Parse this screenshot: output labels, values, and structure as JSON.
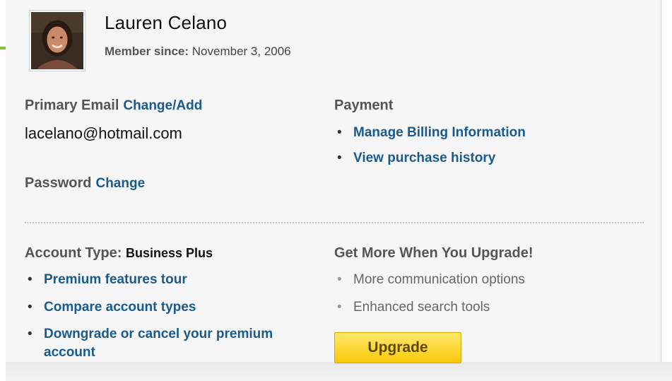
{
  "profile": {
    "name": "Lauren Celano",
    "member_label": "Member since:",
    "member_date": "November 3, 2006",
    "avatar_icon": "profile-photo"
  },
  "email": {
    "label": "Primary Email",
    "change_link": "Change/Add",
    "value": "lacelano@hotmail.com"
  },
  "password": {
    "label": "Password",
    "change_link": "Change"
  },
  "payment": {
    "label": "Payment",
    "links": [
      "Manage Billing Information",
      "View purchase history"
    ]
  },
  "account": {
    "type_label": "Account Type:",
    "type_value": "Business Plus",
    "links": [
      "Premium features tour",
      "Compare account types",
      "Downgrade or cancel your premium account"
    ]
  },
  "upgrade": {
    "heading": "Get More When You Upgrade!",
    "features": [
      "More communication options",
      "Enhanced search tools"
    ],
    "button_label": "Upgrade"
  },
  "colors": {
    "link": "#1a5a8c",
    "button": "#f8c90a",
    "accent_green": "#7fc43a"
  }
}
